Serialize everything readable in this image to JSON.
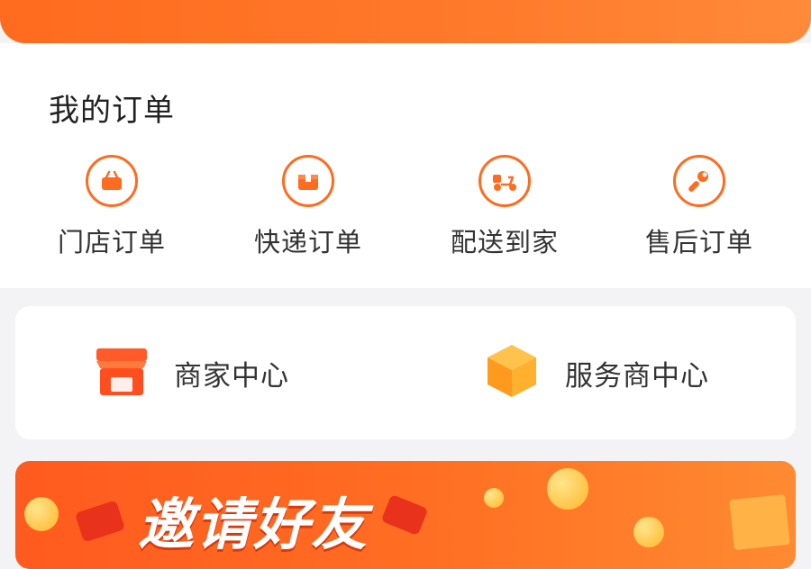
{
  "orders": {
    "title": "我的订单",
    "items": [
      {
        "label": "门店订单",
        "icon": "shopping-basket-icon"
      },
      {
        "label": "快递订单",
        "icon": "package-box-icon"
      },
      {
        "label": "配送到家",
        "icon": "delivery-scooter-icon"
      },
      {
        "label": "售后订单",
        "icon": "wrench-icon"
      }
    ]
  },
  "centers": {
    "items": [
      {
        "label": "商家中心",
        "icon": "storefront-icon"
      },
      {
        "label": "服务商中心",
        "icon": "cube-icon"
      }
    ]
  },
  "banner": {
    "title": "邀请好友"
  },
  "colors": {
    "accent": "#ff6b1f",
    "background": "#f3f3f5"
  }
}
